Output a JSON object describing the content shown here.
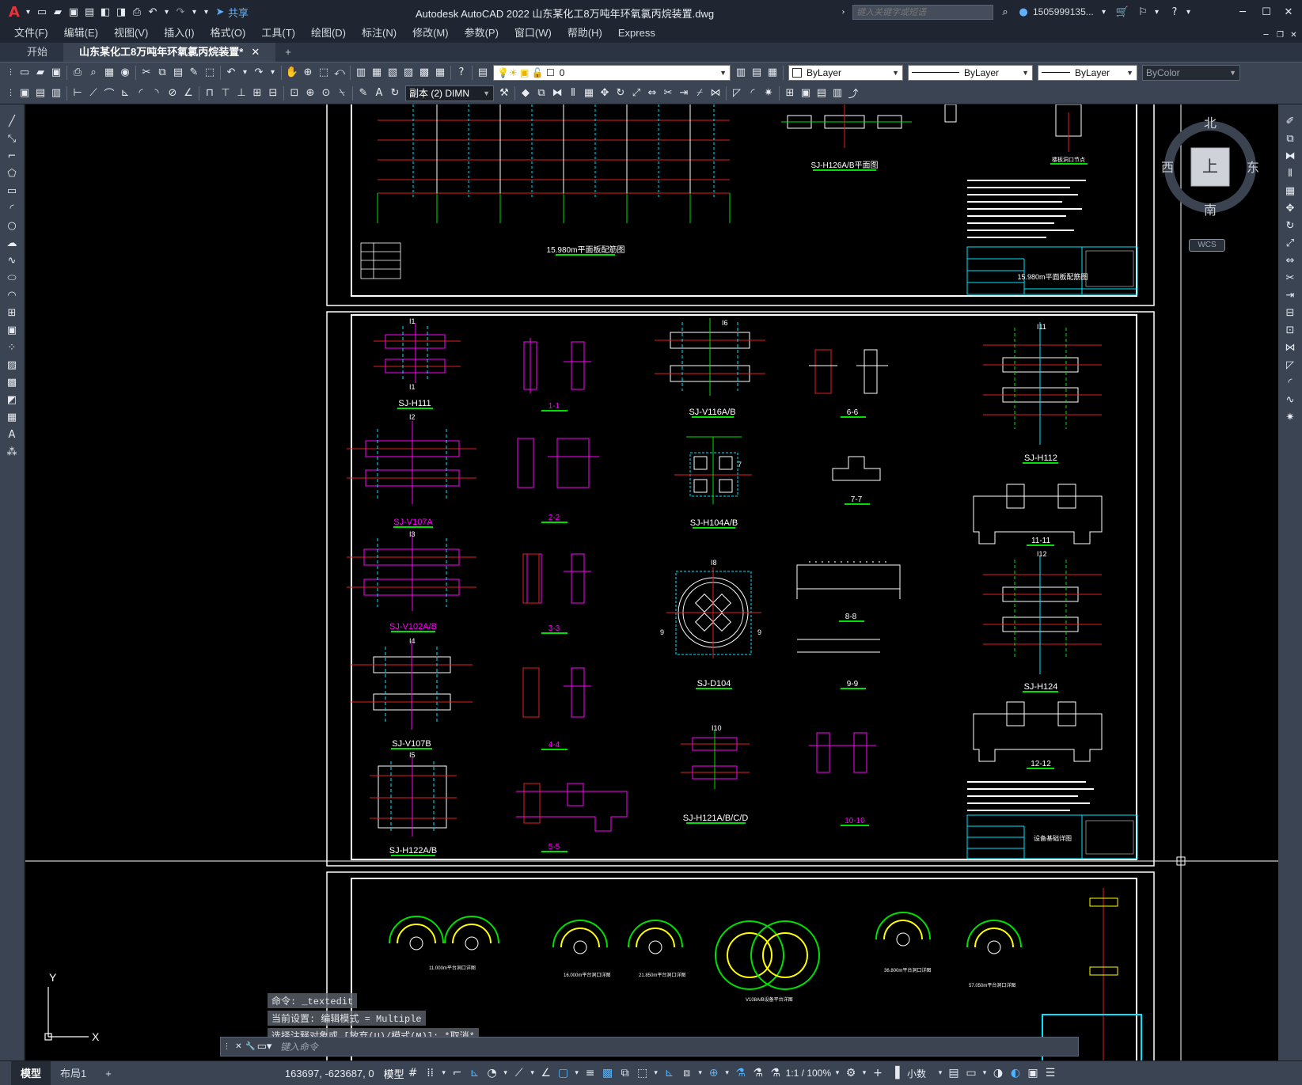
{
  "app": {
    "title": "Autodesk AutoCAD 2022    山东某化工8万吨年环氧氯丙烷装置.dwg",
    "logo": "A",
    "share": "共享",
    "search_placeholder": "键入关键字或短语",
    "user": "1505999135...",
    "icons": [
      "new-icon",
      "open-icon",
      "save-icon",
      "save-as-icon",
      "plot-icon",
      "undo-icon",
      "redo-icon",
      "share-icon",
      "search-icon",
      "user-icon",
      "cart-icon",
      "help-icon",
      "minimize-icon",
      "maximize-icon",
      "close-icon"
    ]
  },
  "menu": [
    "文件(F)",
    "编辑(E)",
    "视图(V)",
    "插入(I)",
    "格式(O)",
    "工具(T)",
    "绘图(D)",
    "标注(N)",
    "修改(M)",
    "参数(P)",
    "窗口(W)",
    "帮助(H)",
    "Express"
  ],
  "tabs": {
    "start": "开始",
    "doc": "山东某化工8万吨年环氧氯丙烷装置*",
    "add": "+"
  },
  "toolbar": {
    "layer_value": "0",
    "dimstyle_value": "副本 (2) DIMN",
    "color_value": "ByLayer",
    "linetype_value": "ByLayer",
    "lineweight_value": "ByLayer",
    "plotstyle_value": "ByColor"
  },
  "viewcube": {
    "north": "北",
    "south": "南",
    "east": "东",
    "west": "西",
    "face": "上",
    "wcs": "WCS"
  },
  "ucs": {
    "y": "Y",
    "x": "X"
  },
  "drawing": {
    "sheet1": {
      "title": "15.980m平面板配筋图",
      "detail": "SJ-H126A/B平面图",
      "opening": "楼板洞口节点",
      "titleblock_name": "15.980m平面板配筋图"
    },
    "sheet2": {
      "labels": [
        "SJ-H111",
        "SJ-V107A",
        "SJ-V102A/B",
        "SJ-V107B",
        "SJ-H122A/B",
        "SJ-V116A/B",
        "SJ-H104A/B",
        "SJ-D104",
        "SJ-H121A/B/C/D",
        "SJ-H112",
        "SJ-H124"
      ],
      "sections": [
        "1-1",
        "2-2",
        "3-3",
        "4-4",
        "5-5",
        "6-6",
        "7-7",
        "8-8",
        "9-9",
        "10-10",
        "11-11",
        "12-12"
      ],
      "tags": [
        "I1",
        "I2",
        "I3",
        "I4",
        "I5",
        "I6",
        "7",
        "I8",
        "9",
        "I10",
        "I11",
        "I12"
      ],
      "titleblock_name": "设备基础详图"
    },
    "sheet3": {
      "notes": [
        "11.000m平台洞口详图",
        "16.000m平台洞口详图",
        "21.850m平台洞口详图",
        "V108A/B设备平台详图",
        "36.800m平台洞口详图",
        "57.050m平台洞口详图"
      ]
    }
  },
  "command": {
    "history": [
      "命令: _textedit",
      "当前设置: 编辑模式 = Multiple",
      "选择注释对象或 [放弃(U)/模式(M)]: *取消*"
    ],
    "placeholder": "键入命令"
  },
  "status": {
    "model_tab": "模型",
    "layout_tab": "布局1",
    "add": "+",
    "coords": "163697, -623687, 0",
    "space": "模型",
    "scale": "1:1 / 100%",
    "units": "小数"
  }
}
